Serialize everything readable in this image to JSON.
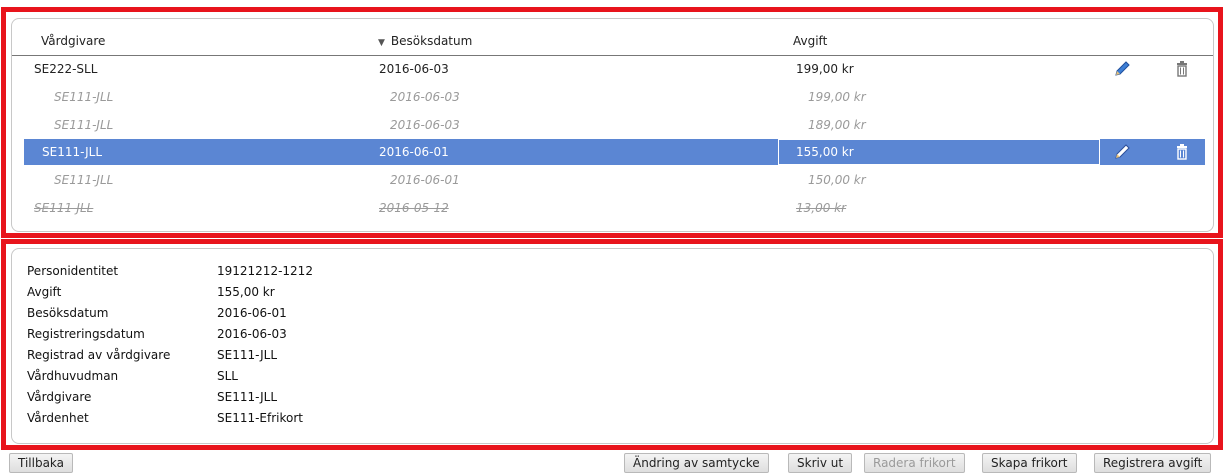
{
  "table": {
    "columns": {
      "provider": "Vårdgivare",
      "visit_date": "Besöksdatum",
      "fee": "Avgift"
    },
    "rows": [
      {
        "provider": "SE222-SLL",
        "visit_date": "2016-06-03",
        "fee": "199,00 kr",
        "kind": "main"
      },
      {
        "provider": "SE111-JLL",
        "visit_date": "2016-06-03",
        "fee": "199,00 kr",
        "kind": "sub"
      },
      {
        "provider": "SE111-JLL",
        "visit_date": "2016-06-03",
        "fee": "189,00 kr",
        "kind": "sub"
      },
      {
        "provider": "SE111-JLL",
        "visit_date": "2016-06-01",
        "fee": "155,00 kr",
        "kind": "selected"
      },
      {
        "provider": "SE111-JLL",
        "visit_date": "2016-06-01",
        "fee": "150,00 kr",
        "kind": "sub"
      },
      {
        "provider": "SE111-JLL",
        "visit_date": "2016-05-12",
        "fee": "13,00 kr",
        "kind": "deleted"
      }
    ],
    "icons": {
      "edit": "pencil-icon",
      "delete": "trash-icon"
    }
  },
  "details": [
    {
      "label": "Personidentitet",
      "value": "19121212-1212"
    },
    {
      "label": "Avgift",
      "value": "155,00 kr"
    },
    {
      "label": "Besöksdatum",
      "value": "2016-06-01"
    },
    {
      "label": "Registreringsdatum",
      "value": "2016-06-03"
    },
    {
      "label": "Registrad av vårdgivare",
      "value": "SE111-JLL"
    },
    {
      "label": "Vårdhuvudman",
      "value": "SLL"
    },
    {
      "label": "Vårdgivare",
      "value": "SE111-JLL"
    },
    {
      "label": "Vårdenhet",
      "value": "SE111-Efrikort"
    }
  ],
  "buttons": {
    "back": "Tillbaka",
    "consent": "Ändring av samtycke",
    "print": "Skriv ut",
    "delete_card": "Radera frikort",
    "create_card": "Skapa frikort",
    "register_fee": "Registrera avgift"
  },
  "colors": {
    "highlight_frame": "#e8141c",
    "selected_row": "#5b86d3"
  }
}
